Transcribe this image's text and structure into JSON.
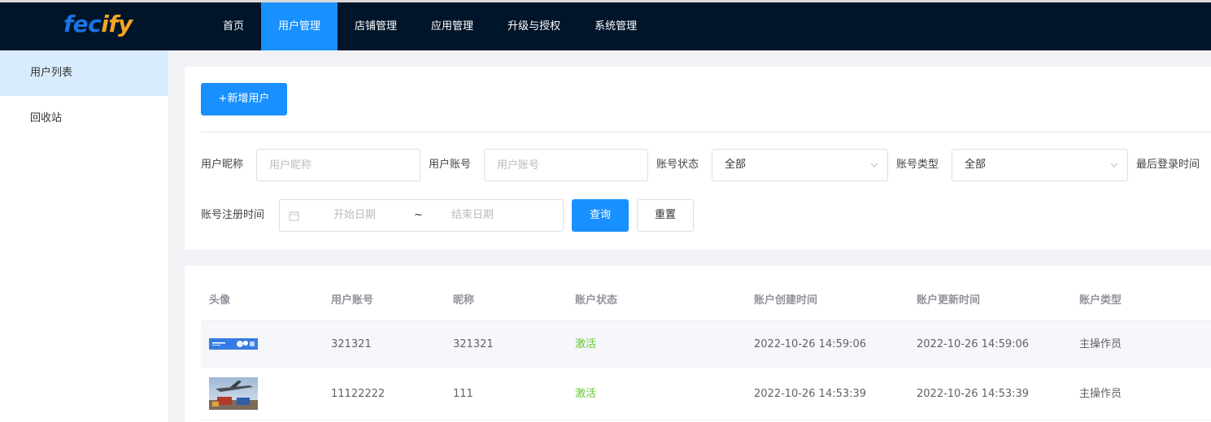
{
  "app": {
    "logo_part1": "fec",
    "logo_part2": "ify",
    "brand_color": "#1890ff",
    "nav_bg": "#001529"
  },
  "nav": {
    "items": [
      "首页",
      "用户管理",
      "店铺管理",
      "应用管理",
      "升级与授权",
      "系统管理"
    ],
    "active_index": 1
  },
  "sidebar": {
    "items": [
      "用户列表",
      "回收站"
    ],
    "active_index": 0
  },
  "toolbar": {
    "add_label": "+新增用户"
  },
  "filters": {
    "nickname_label": "用户昵称",
    "nickname_placeholder": "用户昵称",
    "account_label": "用户账号",
    "account_placeholder": "用户账号",
    "status_label": "账号状态",
    "status_value": "全部",
    "type_label": "账号类型",
    "type_value": "全部",
    "last_login_label": "最后登录时间",
    "register_label": "账号注册时间",
    "date_start_placeholder": "开始日期",
    "date_separator": "~",
    "date_end_placeholder": "结束日期",
    "query_label": "查询",
    "reset_label": "重置"
  },
  "table": {
    "headers": [
      "头像",
      "用户账号",
      "昵称",
      "账户状态",
      "账户创建时间",
      "账户更新时间",
      "账户类型"
    ],
    "rows": [
      {
        "avatar": "banner-thumbnail",
        "account": "321321",
        "nickname": "321321",
        "status": "激活",
        "created": "2022-10-26 14:59:06",
        "updated": "2022-10-26 14:59:06",
        "type": "主操作员"
      },
      {
        "avatar": "airplane-thumbnail",
        "account": "11122222",
        "nickname": "111",
        "status": "激活",
        "created": "2022-10-26 14:53:39",
        "updated": "2022-10-26 14:53:39",
        "type": "主操作员"
      }
    ]
  }
}
